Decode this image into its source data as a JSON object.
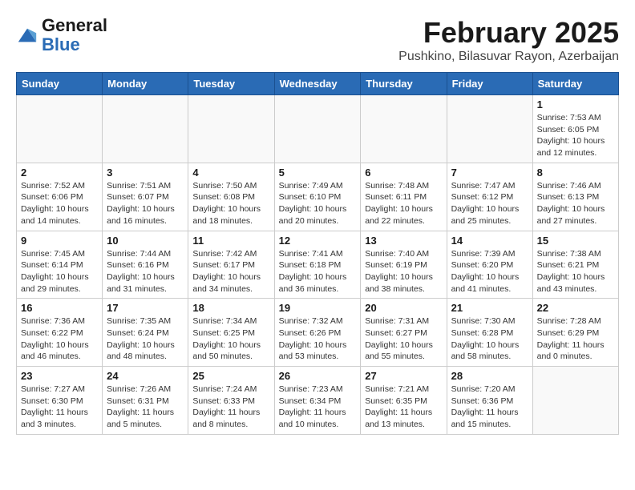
{
  "header": {
    "logo_line1": "General",
    "logo_line2": "Blue",
    "title": "February 2025",
    "location": "Pushkino, Bilasuvar Rayon, Azerbaijan"
  },
  "days_of_week": [
    "Sunday",
    "Monday",
    "Tuesday",
    "Wednesday",
    "Thursday",
    "Friday",
    "Saturday"
  ],
  "weeks": [
    {
      "days": [
        {
          "num": "",
          "info": ""
        },
        {
          "num": "",
          "info": ""
        },
        {
          "num": "",
          "info": ""
        },
        {
          "num": "",
          "info": ""
        },
        {
          "num": "",
          "info": ""
        },
        {
          "num": "",
          "info": ""
        },
        {
          "num": "1",
          "info": "Sunrise: 7:53 AM\nSunset: 6:05 PM\nDaylight: 10 hours and 12 minutes."
        }
      ]
    },
    {
      "days": [
        {
          "num": "2",
          "info": "Sunrise: 7:52 AM\nSunset: 6:06 PM\nDaylight: 10 hours and 14 minutes."
        },
        {
          "num": "3",
          "info": "Sunrise: 7:51 AM\nSunset: 6:07 PM\nDaylight: 10 hours and 16 minutes."
        },
        {
          "num": "4",
          "info": "Sunrise: 7:50 AM\nSunset: 6:08 PM\nDaylight: 10 hours and 18 minutes."
        },
        {
          "num": "5",
          "info": "Sunrise: 7:49 AM\nSunset: 6:10 PM\nDaylight: 10 hours and 20 minutes."
        },
        {
          "num": "6",
          "info": "Sunrise: 7:48 AM\nSunset: 6:11 PM\nDaylight: 10 hours and 22 minutes."
        },
        {
          "num": "7",
          "info": "Sunrise: 7:47 AM\nSunset: 6:12 PM\nDaylight: 10 hours and 25 minutes."
        },
        {
          "num": "8",
          "info": "Sunrise: 7:46 AM\nSunset: 6:13 PM\nDaylight: 10 hours and 27 minutes."
        }
      ]
    },
    {
      "days": [
        {
          "num": "9",
          "info": "Sunrise: 7:45 AM\nSunset: 6:14 PM\nDaylight: 10 hours and 29 minutes."
        },
        {
          "num": "10",
          "info": "Sunrise: 7:44 AM\nSunset: 6:16 PM\nDaylight: 10 hours and 31 minutes."
        },
        {
          "num": "11",
          "info": "Sunrise: 7:42 AM\nSunset: 6:17 PM\nDaylight: 10 hours and 34 minutes."
        },
        {
          "num": "12",
          "info": "Sunrise: 7:41 AM\nSunset: 6:18 PM\nDaylight: 10 hours and 36 minutes."
        },
        {
          "num": "13",
          "info": "Sunrise: 7:40 AM\nSunset: 6:19 PM\nDaylight: 10 hours and 38 minutes."
        },
        {
          "num": "14",
          "info": "Sunrise: 7:39 AM\nSunset: 6:20 PM\nDaylight: 10 hours and 41 minutes."
        },
        {
          "num": "15",
          "info": "Sunrise: 7:38 AM\nSunset: 6:21 PM\nDaylight: 10 hours and 43 minutes."
        }
      ]
    },
    {
      "days": [
        {
          "num": "16",
          "info": "Sunrise: 7:36 AM\nSunset: 6:22 PM\nDaylight: 10 hours and 46 minutes."
        },
        {
          "num": "17",
          "info": "Sunrise: 7:35 AM\nSunset: 6:24 PM\nDaylight: 10 hours and 48 minutes."
        },
        {
          "num": "18",
          "info": "Sunrise: 7:34 AM\nSunset: 6:25 PM\nDaylight: 10 hours and 50 minutes."
        },
        {
          "num": "19",
          "info": "Sunrise: 7:32 AM\nSunset: 6:26 PM\nDaylight: 10 hours and 53 minutes."
        },
        {
          "num": "20",
          "info": "Sunrise: 7:31 AM\nSunset: 6:27 PM\nDaylight: 10 hours and 55 minutes."
        },
        {
          "num": "21",
          "info": "Sunrise: 7:30 AM\nSunset: 6:28 PM\nDaylight: 10 hours and 58 minutes."
        },
        {
          "num": "22",
          "info": "Sunrise: 7:28 AM\nSunset: 6:29 PM\nDaylight: 11 hours and 0 minutes."
        }
      ]
    },
    {
      "days": [
        {
          "num": "23",
          "info": "Sunrise: 7:27 AM\nSunset: 6:30 PM\nDaylight: 11 hours and 3 minutes."
        },
        {
          "num": "24",
          "info": "Sunrise: 7:26 AM\nSunset: 6:31 PM\nDaylight: 11 hours and 5 minutes."
        },
        {
          "num": "25",
          "info": "Sunrise: 7:24 AM\nSunset: 6:33 PM\nDaylight: 11 hours and 8 minutes."
        },
        {
          "num": "26",
          "info": "Sunrise: 7:23 AM\nSunset: 6:34 PM\nDaylight: 11 hours and 10 minutes."
        },
        {
          "num": "27",
          "info": "Sunrise: 7:21 AM\nSunset: 6:35 PM\nDaylight: 11 hours and 13 minutes."
        },
        {
          "num": "28",
          "info": "Sunrise: 7:20 AM\nSunset: 6:36 PM\nDaylight: 11 hours and 15 minutes."
        },
        {
          "num": "",
          "info": ""
        }
      ]
    }
  ]
}
